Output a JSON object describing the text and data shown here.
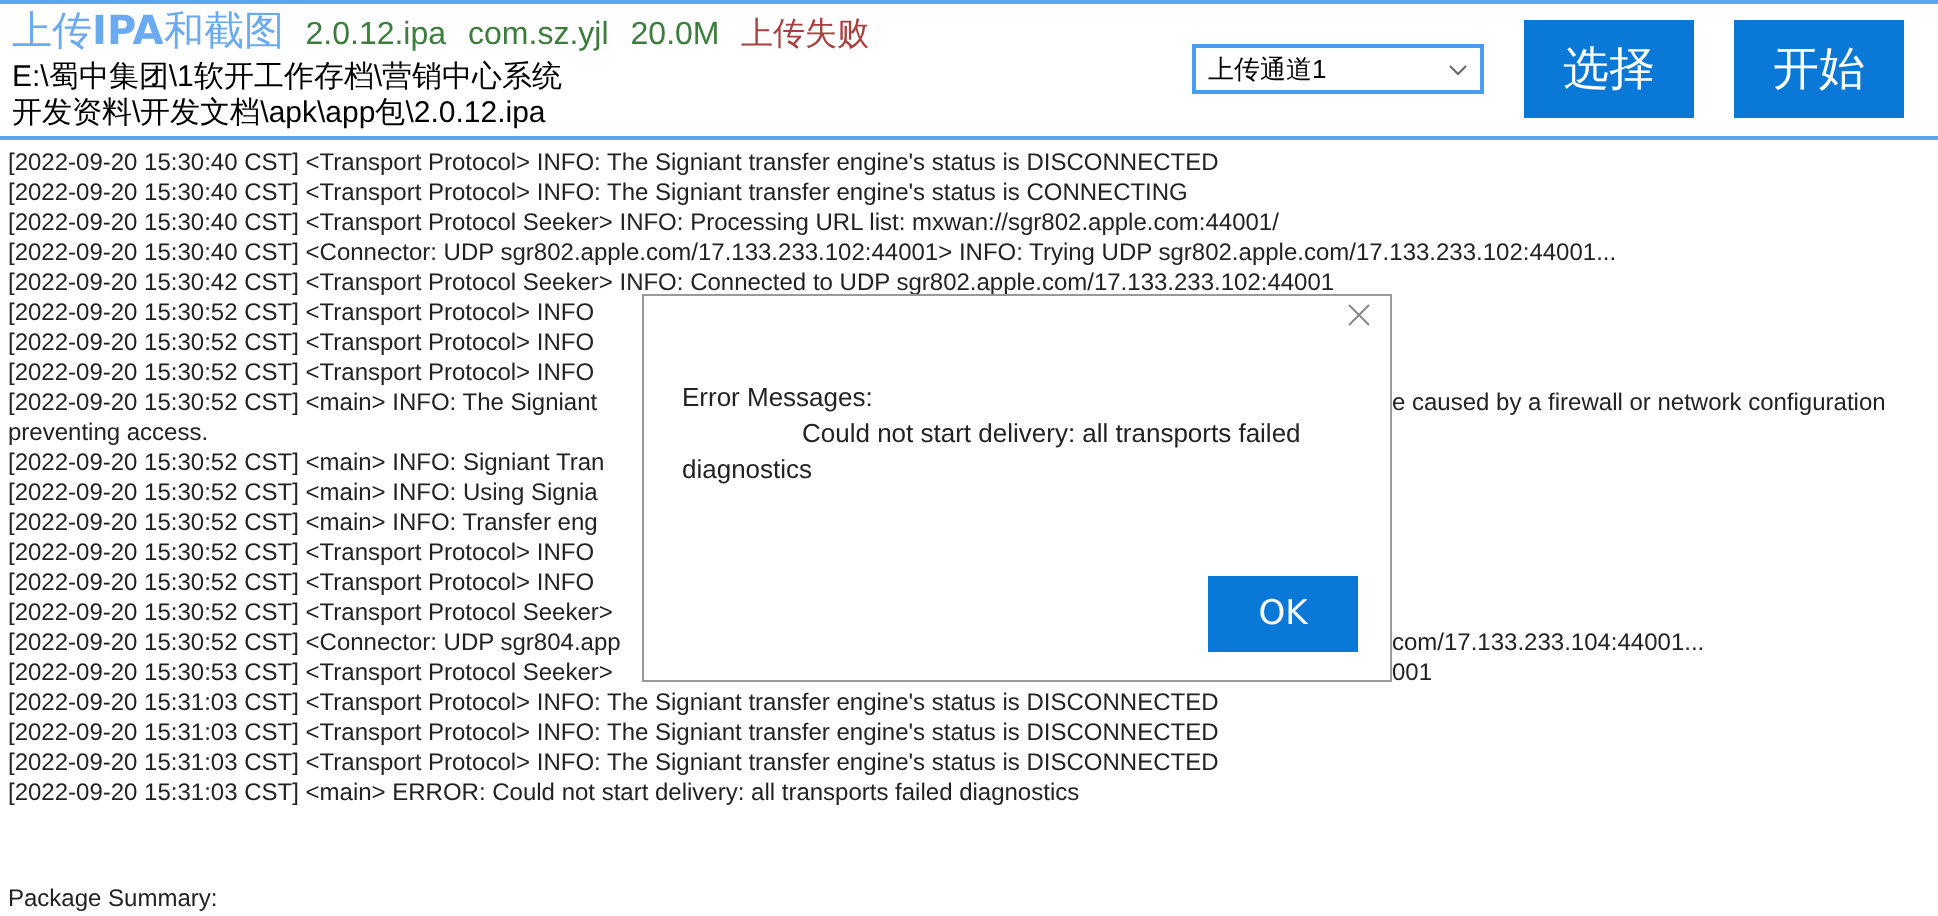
{
  "header": {
    "title": "上传**IPA**和截图",
    "file": "2.0.12.ipa",
    "bundle_id": "com.sz.yjl",
    "size": "20.0M",
    "status": "上传失败",
    "path_lines": [
      "E:\\蜀中集团\\1软开工作存档\\营销中心系统",
      "开发资料\\开发文档\\apk\\app包\\2.0.12.ipa"
    ],
    "channel": {
      "value": "上传通道1"
    },
    "buttons": [
      "选择",
      "开始"
    ]
  },
  "log": [
    {
      "text": "[2022-09-20 15:30:40 CST] <Transport Protocol>  INFO: The Signiant transfer engine's status is DISCONNECTED"
    },
    {
      "text": "[2022-09-20 15:30:40 CST] <Transport Protocol>  INFO: The Signiant transfer engine's status is CONNECTING"
    },
    {
      "text": "[2022-09-20 15:30:40 CST] <Transport Protocol Seeker>  INFO: Processing URL list: mxwan://sgr802.apple.com:44001/"
    },
    {
      "text": "[2022-09-20 15:30:40 CST] <Connector: UDP sgr802.apple.com/17.133.233.102:44001>  INFO: Trying UDP sgr802.apple.com/17.133.233.102:44001..."
    },
    {
      "text": "[2022-09-20 15:30:42 CST] <Transport Protocol Seeker>  INFO: Connected to UDP sgr802.apple.com/17.133.233.102:44001"
    },
    {
      "text": "[2022-09-20 15:30:52 CST] <Transport Protocol>  INFO"
    },
    {
      "text": "[2022-09-20 15:30:52 CST] <Transport Protocol>  INFO"
    },
    {
      "text": "[2022-09-20 15:30:52 CST] <Transport Protocol>  INFO"
    },
    {
      "text": "[2022-09-20 15:30:52 CST] <main>  INFO: The Signiant",
      "tail": "e caused by a firewall or network configuration"
    },
    {
      "text": "preventing access."
    },
    {
      "text": "[2022-09-20 15:30:52 CST] <main>  INFO: Signiant Tran"
    },
    {
      "text": "[2022-09-20 15:30:52 CST] <main>  INFO: Using Signia"
    },
    {
      "text": "[2022-09-20 15:30:52 CST] <main>  INFO: Transfer eng"
    },
    {
      "text": "[2022-09-20 15:30:52 CST] <Transport Protocol>  INFO"
    },
    {
      "text": "[2022-09-20 15:30:52 CST] <Transport Protocol>  INFO"
    },
    {
      "text": "[2022-09-20 15:30:52 CST] <Transport Protocol Seeker>"
    },
    {
      "text": "[2022-09-20 15:30:52 CST] <Connector: UDP sgr804.app",
      "tail": "com/17.133.233.104:44001..."
    },
    {
      "text": "[2022-09-20 15:30:53 CST] <Transport Protocol Seeker>",
      "tail": "001"
    },
    {
      "text": "[2022-09-20 15:31:03 CST] <Transport Protocol>  INFO: The Signiant transfer engine's status is DISCONNECTED"
    },
    {
      "text": "[2022-09-20 15:31:03 CST] <Transport Protocol>  INFO: The Signiant transfer engine's status is DISCONNECTED"
    },
    {
      "text": "[2022-09-20 15:31:03 CST] <Transport Protocol>  INFO: The Signiant transfer engine's status is DISCONNECTED"
    },
    {
      "text": "[2022-09-20 15:31:03 CST] <main> ERROR: Could not start delivery: all transports failed diagnostics"
    }
  ],
  "summary": "Package Summary:",
  "dialog": {
    "heading": "Error Messages:",
    "message": "Could not start delivery: all transports failed diagnostics",
    "button": "OK"
  }
}
